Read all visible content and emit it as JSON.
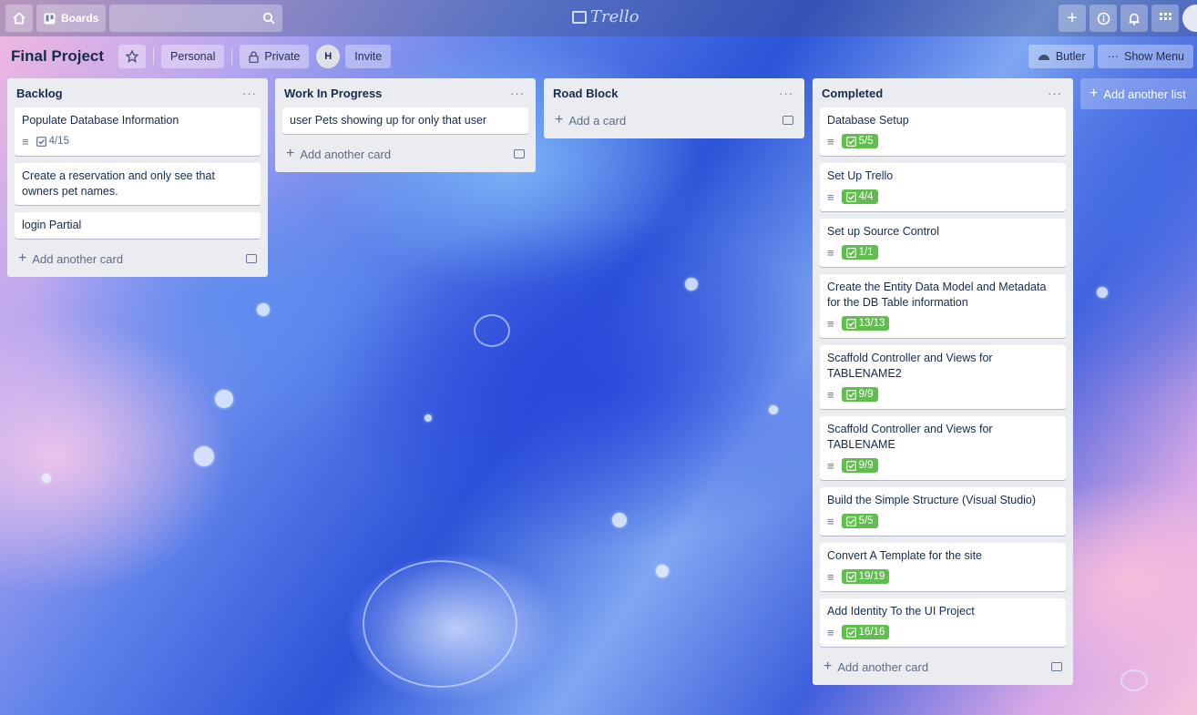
{
  "topbar": {
    "home_icon": "home-icon",
    "boards_label": "Boards",
    "search_icon": "search-icon",
    "logo_text": "Trello",
    "plus_icon": "plus-icon",
    "info_icon": "info-icon",
    "bell_icon": "bell-icon",
    "apps_icon": "apps-icon"
  },
  "board": {
    "title": "Final Project",
    "personal_label": "Personal",
    "private_label": "Private",
    "member_initial": "H",
    "invite_label": "Invite",
    "butler_label": "Butler",
    "show_menu_label": "Show Menu"
  },
  "lists": [
    {
      "title": "Backlog",
      "menu": "···",
      "cards": [
        {
          "title": "Populate Database Information",
          "has_description": true,
          "checklist": "4/15",
          "complete": false
        },
        {
          "title": "Create a reservation and only see that owners pet names."
        },
        {
          "title": "login Partial"
        }
      ],
      "add_label": "Add another card"
    },
    {
      "title": "Work In Progress",
      "menu": "···",
      "cards": [
        {
          "title": "user Pets showing up for only that user"
        }
      ],
      "add_label": "Add another card"
    },
    {
      "title": "Road Block",
      "menu": "···",
      "cards": [],
      "add_label": "Add a card"
    },
    {
      "title": "Completed",
      "menu": "···",
      "cards": [
        {
          "title": "Database Setup",
          "has_description": true,
          "checklist": "5/5",
          "complete": true
        },
        {
          "title": "Set Up Trello",
          "has_description": true,
          "checklist": "4/4",
          "complete": true
        },
        {
          "title": "Set up Source Control",
          "has_description": true,
          "checklist": "1/1",
          "complete": true
        },
        {
          "title": "Create the Entity Data Model and Metadata for the DB Table information",
          "has_description": true,
          "checklist": "13/13",
          "complete": true
        },
        {
          "title": "Scaffold Controller and Views for TABLENAME2",
          "has_description": true,
          "checklist": "9/9",
          "complete": true
        },
        {
          "title": "Scaffold Controller and Views for TABLENAME",
          "has_description": true,
          "checklist": "9/9",
          "complete": true
        },
        {
          "title": "Build the Simple Structure (Visual Studio)",
          "has_description": true,
          "checklist": "5/5",
          "complete": true
        },
        {
          "title": "Convert A Template for the site",
          "has_description": true,
          "checklist": "19/19",
          "complete": true
        },
        {
          "title": "Add Identity To the UI Project",
          "has_description": true,
          "checklist": "16/16",
          "complete": true
        }
      ],
      "add_label": "Add another card"
    }
  ],
  "add_list_label": "Add another list",
  "colors": {
    "list_bg": "#ebecf0",
    "badge_complete": "#61bd4f",
    "text": "#172b4d"
  }
}
